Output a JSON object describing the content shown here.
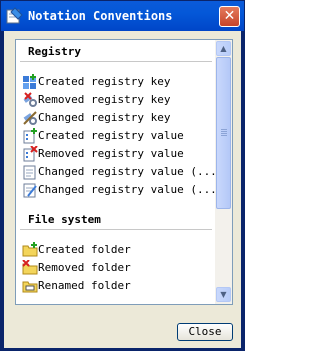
{
  "window": {
    "title": "Notation Conventions"
  },
  "sections": [
    {
      "title": "Registry",
      "items": [
        {
          "label": "Created registry key",
          "icon": "registry-key-add-icon"
        },
        {
          "label": "Removed registry key",
          "icon": "registry-key-remove-icon"
        },
        {
          "label": "Changed registry key",
          "icon": "registry-key-edit-icon"
        },
        {
          "label": "Created registry value",
          "icon": "registry-value-add-icon"
        },
        {
          "label": "Removed registry value",
          "icon": "registry-value-remove-icon"
        },
        {
          "label": "Changed registry value (...",
          "icon": "registry-value-edit-icon"
        },
        {
          "label": "Changed registry value (...",
          "icon": "registry-value-edit-alt-icon"
        }
      ]
    },
    {
      "title": "File system",
      "items": [
        {
          "label": "Created folder",
          "icon": "folder-add-icon"
        },
        {
          "label": "Removed folder",
          "icon": "folder-remove-icon"
        },
        {
          "label": "Renamed folder",
          "icon": "folder-rename-icon"
        }
      ]
    }
  ],
  "buttons": {
    "close": "Close"
  },
  "colors": {
    "titlebar": "#0458d8",
    "client": "#ece9d8",
    "panel_border": "#7f9db9"
  }
}
